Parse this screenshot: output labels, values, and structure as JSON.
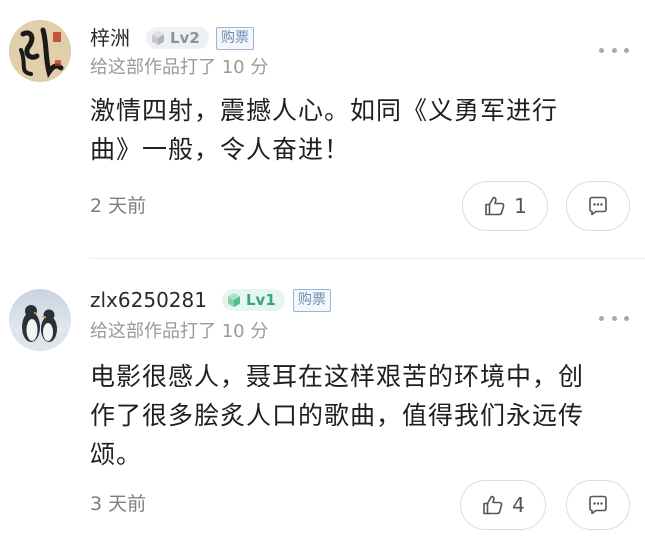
{
  "comments": [
    {
      "username": "梓洲",
      "level": "Lv2",
      "ticket_badge": "购票",
      "rating_text": "给这部作品打了 10 分",
      "content_lines": [
        "激情四射，震撼人心。如同《义勇军进行",
        "曲》一般，令人奋进！"
      ],
      "time": "2 天前",
      "like_count": "1",
      "avatar_icon": "calligraphy-avatar",
      "level_color": "#8d929a"
    },
    {
      "username": "zlx6250281",
      "level": "Lv1",
      "ticket_badge": "购票",
      "rating_text": "给这部作品打了 10 分",
      "content_lines": [
        "电影很感人，聂耳在这样艰苦的环境中，创",
        "作了很多脍炙人口的歌曲，值得我们永远传",
        "颂。"
      ],
      "time": "3 天前",
      "like_count": "4",
      "avatar_icon": "penguins-avatar",
      "level_color": "#3fa47c"
    }
  ],
  "icons": {
    "more": "more-dots-icon",
    "like": "thumbs-up-icon",
    "reply": "comment-bubble-icon",
    "level_gem": "gem-icon"
  }
}
